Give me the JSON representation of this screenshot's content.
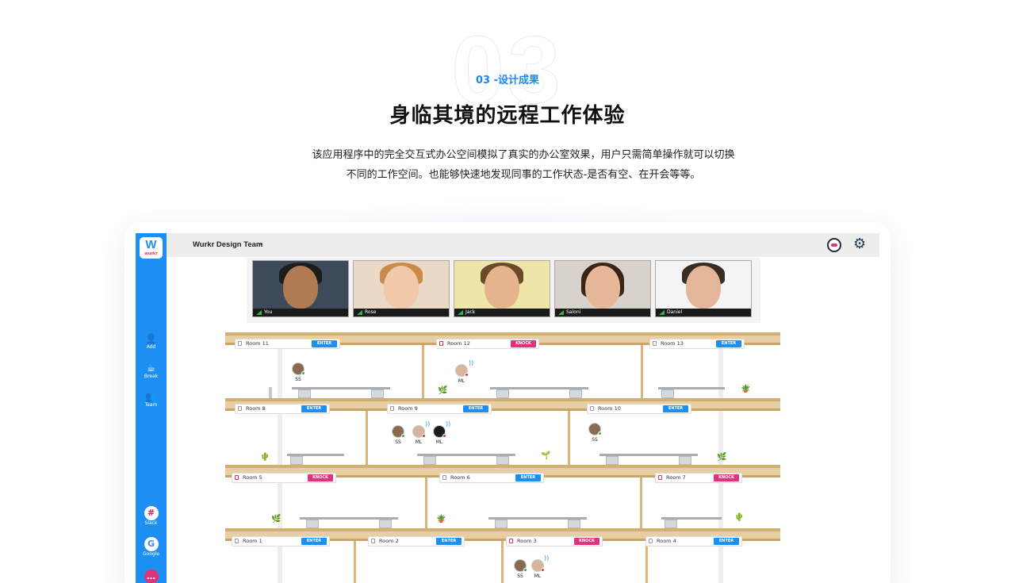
{
  "header": {
    "big_number": "03",
    "section_tag": "03 -设计成果",
    "headline": "身临其境的远程工作体验",
    "description": "该应用程序中的完全交互式办公空间模拟了真实的办公室效果，用户只需简单操作就可以切换不同的工作空间。也能够快速地发现同事的工作状态-是否有空、在开会等等。"
  },
  "app": {
    "logo_text": "W",
    "logo_sub": "wurkr",
    "team_name": "Wurkr Design Team",
    "sidebar": {
      "add": "Add",
      "break": "Break",
      "team": "Team",
      "slack": "Slack",
      "google": "Google"
    },
    "participants": [
      "You",
      "Rose",
      "Jack",
      "Saloni",
      "Daniel"
    ],
    "rooms": {
      "r11": {
        "name": "Room 11",
        "action": "ENTER"
      },
      "r12": {
        "name": "Room 12",
        "action": "KNOCK"
      },
      "r13": {
        "name": "Room 13",
        "action": "ENTER"
      },
      "r8": {
        "name": "Room 8",
        "action": "ENTER"
      },
      "r9": {
        "name": "Room 9",
        "action": "ENTER"
      },
      "r10": {
        "name": "Room 10",
        "action": "ENTER"
      },
      "r5": {
        "name": "Room 5",
        "action": "KNOCK"
      },
      "r6": {
        "name": "Room 6",
        "action": "ENTER"
      },
      "r7": {
        "name": "Room 7",
        "action": "KNOCK"
      },
      "r1": {
        "name": "Room 1",
        "action": "ENTER"
      },
      "r2": {
        "name": "Room 2",
        "action": "ENTER"
      },
      "r3": {
        "name": "Room 3",
        "action": "KNOCK"
      },
      "r4": {
        "name": "Room 4",
        "action": "ENTER"
      }
    },
    "people": {
      "ss": "SS",
      "ml": "ML"
    },
    "colors": {
      "accent": "#1e8ff2",
      "knock": "#e2327a",
      "available": "#36b24a",
      "busy": "#e0324f"
    }
  }
}
